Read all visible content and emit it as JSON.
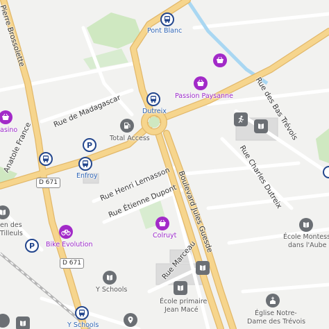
{
  "streets": {
    "pierre_brossolette": "Pierre Brossolette",
    "madagascar": "Rue de Madagascar",
    "anatole_france": "Anatole France",
    "henri_lemasson": "Rue Henri Lemasson",
    "etienne_dupont": "Rue Étienne Dupont",
    "jules_guesde": "Boulevard Jules Guesde",
    "marceau": "Rue Marceau",
    "charles_dutreix": "Rue Charles Dutreix",
    "bas_trevois": "Rue des Bas Trévois"
  },
  "shields": {
    "d671_top": "D 671",
    "d671_bottom": "D 671"
  },
  "stops": {
    "pont_blanc": "Pont Blanc",
    "dutreix": "Dutreix",
    "enfroy": "Enfroy",
    "y_schools_stop": "Y Schools"
  },
  "pois": {
    "passion_paysanne": "Passion Paysanne",
    "casino": "asino",
    "total_access": "Total Access",
    "bike_evolution": "Bike Evolution",
    "colruyt": "Colruyt",
    "y_schools": "Y Schools",
    "ecole_primaire_l1": "École primaire",
    "ecole_primaire_l2": "Jean Macé",
    "montessori_l1": "École Montessori",
    "montessori_l2": "dans l'Aube",
    "eglise_l1": "Église Notre-",
    "eglise_l2": "Dame des Trévois",
    "tilleuls_l1": "en des",
    "tilleuls_l2": "Tilleuls",
    "parking_label": "P"
  },
  "icons": {
    "bus": "bus-icon",
    "parking": "parking-icon",
    "shop": "shopping-basket-icon",
    "fuel": "fuel-icon",
    "bike": "bicycle-icon",
    "school": "school-icon",
    "church": "church-icon"
  },
  "colors": {
    "major_road": "#f6d58d",
    "major_road_casing": "#e2b86a",
    "water": "#a9d7f2",
    "park": "#cfe8c1",
    "transit_blue": "#23468d",
    "shop_purple": "#a22ac8",
    "gray_poi": "#6b6f74"
  }
}
